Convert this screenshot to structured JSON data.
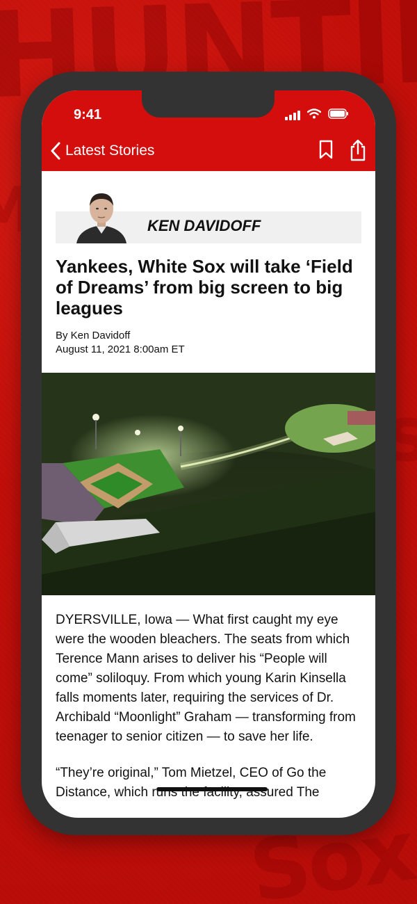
{
  "status": {
    "time": "9:41"
  },
  "nav": {
    "back_label": "Latest Stories"
  },
  "author": {
    "name": "KEN DAVIDOFF"
  },
  "article": {
    "headline": "Yankees, White Sox will take ‘Field of Dreams’ from big screen to big leagues",
    "byline": "By Ken Davidoff",
    "date": "August 11, 2021 8:00am ET",
    "paragraphs": [
      "DYERSVILLE, Iowa — What first caught my eye were the wooden bleachers. The seats from which Terence Mann arises to deliver his “People will come” soliloquy. From which young Karin Kinsella falls moments later, requiring the services of Dr. Archibald “Moonlight” Graham — transforming from teenager to senior citizen — to save her life.",
      "“They’re original,” Tom Mietzel, CEO of Go the Distance, which runs the facility, assured The"
    ]
  },
  "colors": {
    "brand_red": "#d40d0d",
    "background_red": "#c8100b",
    "phone_frame": "#333333"
  },
  "icons": [
    "signal-icon",
    "wifi-icon",
    "battery-icon",
    "back-chevron-icon",
    "bookmark-icon",
    "share-icon"
  ]
}
